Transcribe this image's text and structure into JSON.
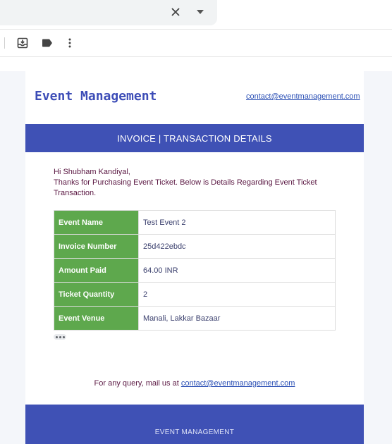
{
  "search_bar": {
    "clear_icon": "close-icon",
    "options_icon": "caret-down-icon"
  },
  "toolbar": {
    "icons": [
      "move-to-inbox-icon",
      "label-icon",
      "more-vert-icon"
    ]
  },
  "email": {
    "brand": "Event Management",
    "header_link": "contact@eventmanagement.com",
    "banner": "INVOICE | TRANSACTION DETAILS",
    "greeting_line1": "Hi Shubham Kandiyal,",
    "greeting_line2": "Thanks for Purchasing Event Ticket. Below is Details Regarding Event Ticket Transaction.",
    "details": [
      {
        "label": "Event Name",
        "value": "Test Event 2"
      },
      {
        "label": "Invoice Number",
        "value": "25d422ebdc"
      },
      {
        "label": "Amount Paid",
        "value": "64.00 INR"
      },
      {
        "label": "Ticket Quantity",
        "value": "2"
      },
      {
        "label": "Event Venue",
        "value": "Manali, Lakkar Bazaar"
      }
    ],
    "query_text": "For any query, mail us at",
    "query_link": "contact@eventmanagement.com",
    "footer": "EVENT MANAGEMENT",
    "colors": {
      "primary": "#3f51b5",
      "label_bg": "#5ea84d",
      "text": "#5a1742",
      "link": "#2a4fb5"
    }
  }
}
